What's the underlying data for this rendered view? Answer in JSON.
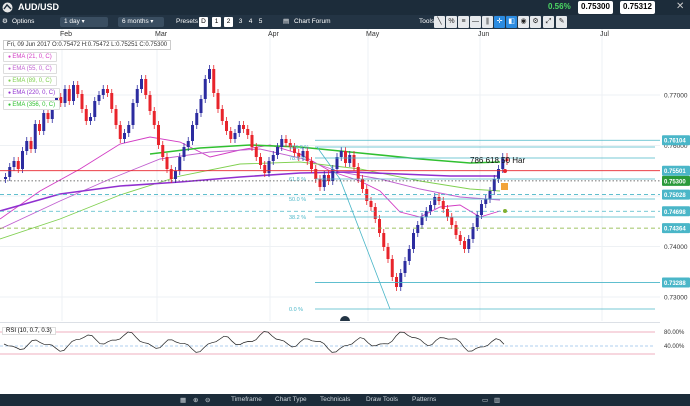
{
  "window": {
    "title": "AUD/USD",
    "change_pct": "0.56%",
    "sell_price": "0.75300",
    "buy_price": "0.75312"
  },
  "toolbar": {
    "options": "Options",
    "interval": "1 day",
    "range": "6 months",
    "presets": "Presets",
    "preset_buttons": [
      "D",
      "1",
      "2",
      "3",
      "4",
      "5"
    ],
    "chart_forum": "Chart Forum",
    "tools_label": "Tools"
  },
  "chart": {
    "ohlc_info": "Fri, 09 Jun 2017 O:0.75472 H:0.75472 L:0.75251 C:0.75300",
    "month_labels": [
      "Feb",
      "Mar",
      "Apr",
      "May",
      "Jun",
      "Jul"
    ],
    "price_labels": [
      "0.77000",
      "0.76000",
      "0.75000",
      "0.74000",
      "0.73000"
    ],
    "highlight_prices": [
      {
        "value": "0.76104",
        "color": "#4ab6c8"
      },
      {
        "value": "0.75501",
        "color": "#4ab6c8"
      },
      {
        "value": "0.75300",
        "color": "#2a9a3a"
      },
      {
        "value": "0.75028",
        "color": "#4ab6c8"
      },
      {
        "value": "0.74698",
        "color": "#4ab6c8"
      },
      {
        "value": "0.74364",
        "color": "#4ab6c8"
      },
      {
        "value": "0.73288",
        "color": "#4ab6c8"
      }
    ],
    "indicators": [
      {
        "label": "EMA (21, 0, C)",
        "color": "#d23cc4"
      },
      {
        "label": "EMA (55, 0, C)",
        "color": "#c060d0"
      },
      {
        "label": "EMA (89, 0, C)",
        "color": "#80d050"
      },
      {
        "label": "EMA (220, 0, C)",
        "color": "#9030d0"
      },
      {
        "label": "EMA (356, 0, C)",
        "color": "#30c030"
      }
    ],
    "fib_labels": [
      "100.0 %",
      "78.6 %",
      "61.8 %",
      "50.0 %",
      "38.2 %",
      "0.0 %"
    ],
    "annotation": "786 618 50 Har"
  },
  "rsi": {
    "label": "RSI (10, 0.7, 0.3)",
    "levels": [
      "80.00%",
      "40.00%"
    ]
  },
  "bottom_tabs": [
    "Timeframe",
    "Chart Type",
    "Technicals",
    "Draw Tools",
    "Patterns"
  ]
}
